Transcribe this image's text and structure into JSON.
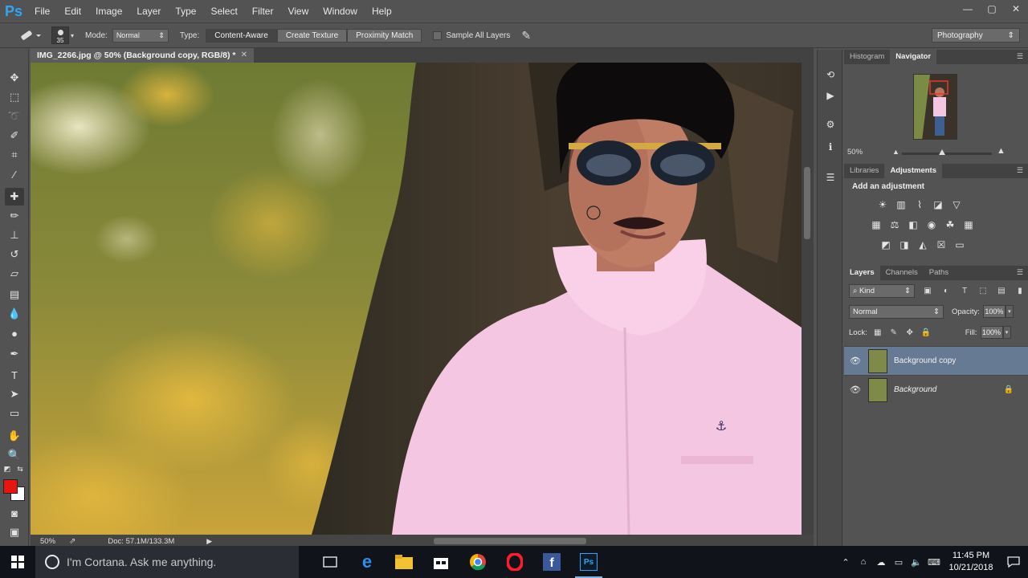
{
  "menubar": {
    "logo": "Ps",
    "items": [
      "File",
      "Edit",
      "Image",
      "Layer",
      "Type",
      "Select",
      "Filter",
      "View",
      "Window",
      "Help"
    ],
    "window_controls": [
      "—",
      "▢",
      "✕"
    ]
  },
  "options": {
    "brush_size": "35",
    "mode_label": "Mode:",
    "mode_value": "Normal",
    "type_label": "Type:",
    "type_buttons": [
      "Content-Aware",
      "Create Texture",
      "Proximity Match"
    ],
    "sample_all_layers": "Sample All Layers",
    "workspace": "Photography"
  },
  "document": {
    "tab_title": "IMG_2266.jpg @ 50% (Background copy, RGB/8) *",
    "zoom": "50%",
    "doc_size": "Doc: 57.1M/133.3M"
  },
  "navigator": {
    "tabs": [
      "Histogram",
      "Navigator"
    ],
    "active_tab": "Navigator",
    "zoom": "50%",
    "zoom_fraction": 0.45
  },
  "adjustments": {
    "tabs": [
      "Libraries",
      "Adjustments"
    ],
    "active_tab": "Adjustments",
    "title": "Add an adjustment"
  },
  "layers": {
    "tabs": [
      "Layers",
      "Channels",
      "Paths"
    ],
    "active_tab": "Layers",
    "kind": "Kind",
    "blend_mode": "Normal",
    "opacity_label": "Opacity:",
    "opacity": "100%",
    "lock_label": "Lock:",
    "fill_label": "Fill:",
    "fill": "100%",
    "items": [
      {
        "name": "Background copy",
        "selected": true,
        "locked": false
      },
      {
        "name": "Background",
        "selected": false,
        "locked": true
      }
    ]
  },
  "colors": {
    "foreground": "#e8140f",
    "background": "#ffffff",
    "selected_layer": "#667a94"
  },
  "taskbar": {
    "cortana_placeholder": "I'm Cortana. Ask me anything.",
    "time": "11:45 PM",
    "date": "10/21/2018"
  }
}
